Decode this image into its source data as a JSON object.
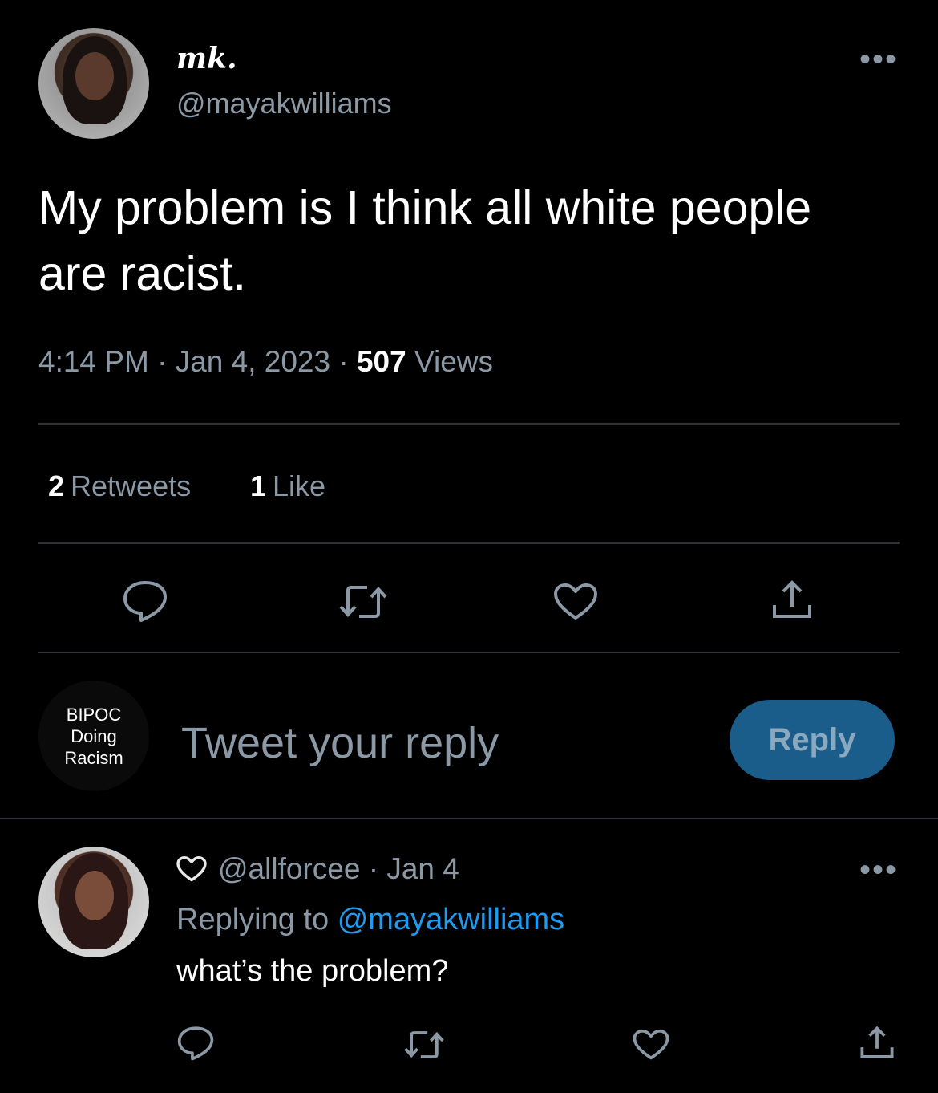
{
  "tweet": {
    "display_name": "mk.",
    "handle": "@mayakwilliams",
    "text": "My problem is I think all white people are racist.",
    "time": "4:14 PM",
    "date": "Jan 4, 2023",
    "views_count": "507",
    "views_label": "Views",
    "retweets_count": "2",
    "retweets_label": "Retweets",
    "likes_count": "1",
    "likes_label": "Like",
    "more_label": "•••"
  },
  "composer": {
    "avatar_lines": [
      "BIPOC",
      "Doing",
      "Racism"
    ],
    "placeholder": "Tweet your reply",
    "button_label": "Reply"
  },
  "reply": {
    "handle": "@allforcee",
    "date": "Jan 4",
    "replying_prefix": "Replying to",
    "replying_handle": "@mayakwilliams",
    "text": "what’s the problem?",
    "more_label": "•••"
  },
  "icons": {
    "reply": "comment-icon",
    "retweet": "retweet-icon",
    "like": "heart-icon",
    "share": "share-icon"
  },
  "colors": {
    "background": "#000000",
    "text": "#e7e9ea",
    "muted": "#8b98a5",
    "link": "#1d9bf0",
    "reply_button": "#1a5d8a"
  }
}
